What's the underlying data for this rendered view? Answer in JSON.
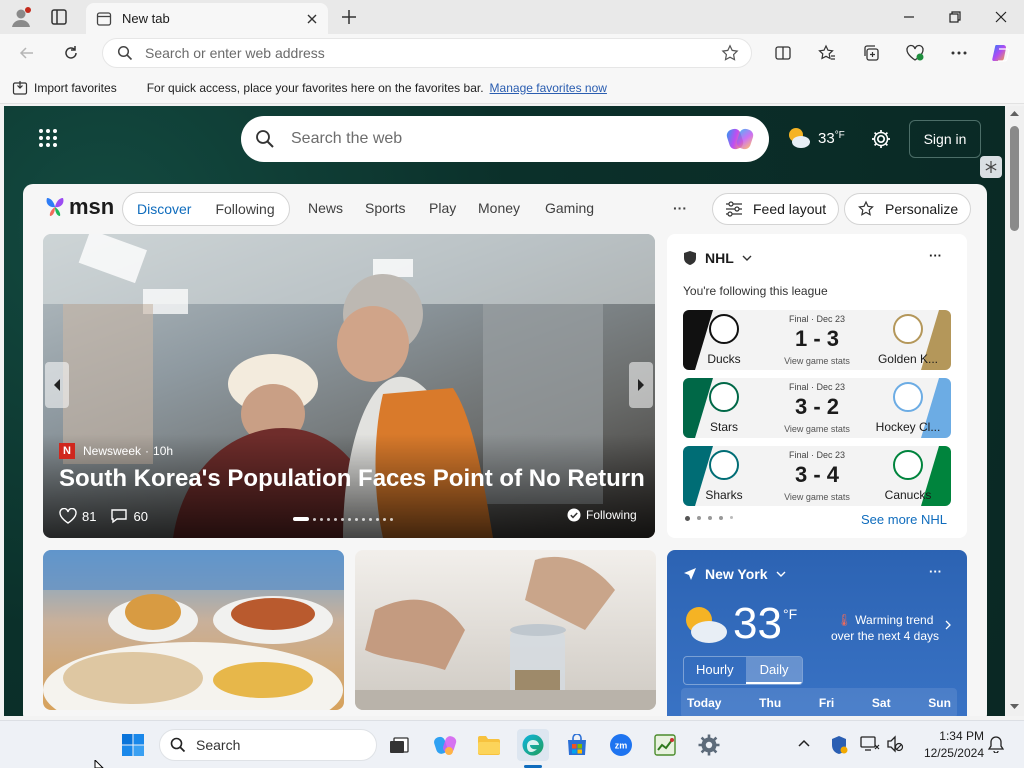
{
  "browser": {
    "tab_title": "New tab",
    "address_placeholder": "Search or enter web address"
  },
  "favorites_bar": {
    "import_label": "Import favorites",
    "hint": "For quick access, place your favorites here on the favorites bar.",
    "manage_link": "Manage favorites now"
  },
  "msn": {
    "search_placeholder": "Search the web",
    "weather_temp": "33",
    "weather_unit": "°F",
    "sign_in": "Sign in",
    "logo": "msn",
    "tabs": [
      "Discover",
      "Following"
    ],
    "nav": [
      "News",
      "Sports",
      "Play",
      "Money",
      "Gaming"
    ],
    "more": "···",
    "feed_layout": "Feed layout",
    "personalize": "Personalize"
  },
  "hero": {
    "source": "Newsweek",
    "age": "10h",
    "headline": "South Korea's Population Faces Point of No Return",
    "likes": "81",
    "comments": "60",
    "following": "Following"
  },
  "nhl": {
    "title": "NHL",
    "following_text": "You're following this league",
    "see_more": "See more NHL",
    "games": [
      {
        "status": "Final · Dec 23",
        "score": "1 - 3",
        "home": "Ducks",
        "away": "Golden K...",
        "stats": "View game stats",
        "home_color": "#111111",
        "away_color": "#b4975a"
      },
      {
        "status": "Final · Dec 23",
        "score": "3 - 2",
        "home": "Stars",
        "away": "Hockey Cl...",
        "stats": "View game stats",
        "home_color": "#006847",
        "away_color": "#6cace4"
      },
      {
        "status": "Final · Dec 23",
        "score": "3 - 4",
        "home": "Sharks",
        "away": "Canucks",
        "stats": "View game stats",
        "home_color": "#006d75",
        "away_color": "#00843d"
      }
    ]
  },
  "weather": {
    "city": "New York",
    "temp": "33",
    "unit": "°F",
    "trend_title": "Warming trend",
    "trend_sub": "over the next 4 days",
    "tabs": [
      "Hourly",
      "Daily"
    ],
    "days": [
      "Today",
      "Thu",
      "Fri",
      "Sat",
      "Sun"
    ]
  },
  "taskbar": {
    "search_label": "Search",
    "time": "1:34 PM",
    "date": "12/25/2024"
  }
}
